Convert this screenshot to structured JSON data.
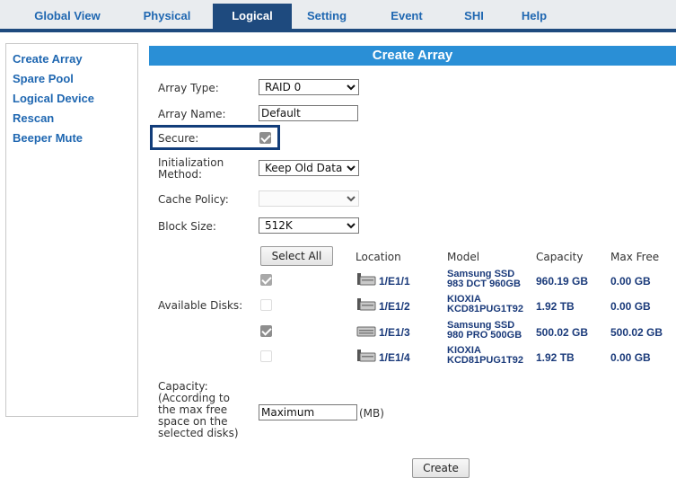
{
  "nav": {
    "tabs": [
      {
        "label": "Global View"
      },
      {
        "label": "Physical"
      },
      {
        "label": "Logical",
        "active": true
      },
      {
        "label": "Setting"
      },
      {
        "label": "Event"
      },
      {
        "label": "SHI"
      },
      {
        "label": "Help"
      }
    ]
  },
  "sidebar": {
    "items": [
      {
        "label": "Create Array"
      },
      {
        "label": "Spare Pool"
      },
      {
        "label": "Logical Device"
      },
      {
        "label": "Rescan"
      },
      {
        "label": "Beeper Mute"
      }
    ]
  },
  "panel": {
    "title": "Create Array"
  },
  "form": {
    "array_type": {
      "label": "Array Type:",
      "value": "RAID 0"
    },
    "array_name": {
      "label": "Array Name:",
      "value": "Default"
    },
    "secure": {
      "label": "Secure:",
      "checked": true
    },
    "init_method": {
      "label_line1": "Initialization",
      "label_line2": "Method:",
      "value": "Keep Old Data"
    },
    "cache_policy": {
      "label": "Cache Policy:",
      "value": ""
    },
    "block_size": {
      "label": "Block Size:",
      "value": "512K"
    },
    "available_disks_label": "Available Disks:",
    "select_all_label": "Select All",
    "columns": {
      "location": "Location",
      "model": "Model",
      "capacity": "Capacity",
      "max_free": "Max Free"
    },
    "disks": [
      {
        "checked": true,
        "disabled": true,
        "location": "1/E1/1",
        "model_line1": "Samsung SSD",
        "model_line2": "983 DCT 960GB",
        "capacity": "960.19 GB",
        "max_free": "0.00 GB"
      },
      {
        "checked": false,
        "disabled": true,
        "location": "1/E1/2",
        "model_line1": "KIOXIA",
        "model_line2": "KCD81PUG1T92",
        "capacity": "1.92 TB",
        "max_free": "0.00 GB"
      },
      {
        "checked": true,
        "disabled": false,
        "location": "1/E1/3",
        "model_line1": "Samsung SSD",
        "model_line2": "980 PRO 500GB",
        "capacity": "500.02 GB",
        "max_free": "500.02 GB"
      },
      {
        "checked": false,
        "disabled": true,
        "location": "1/E1/4",
        "model_line1": "KIOXIA",
        "model_line2": "KCD81PUG1T92",
        "capacity": "1.92 TB",
        "max_free": "0.00 GB"
      }
    ],
    "capacity": {
      "label_lines": [
        "Capacity:",
        "(According to",
        "the max free",
        "space on the",
        "selected disks)"
      ],
      "value": "Maximum",
      "unit": "(MB)"
    },
    "create_label": "Create"
  }
}
